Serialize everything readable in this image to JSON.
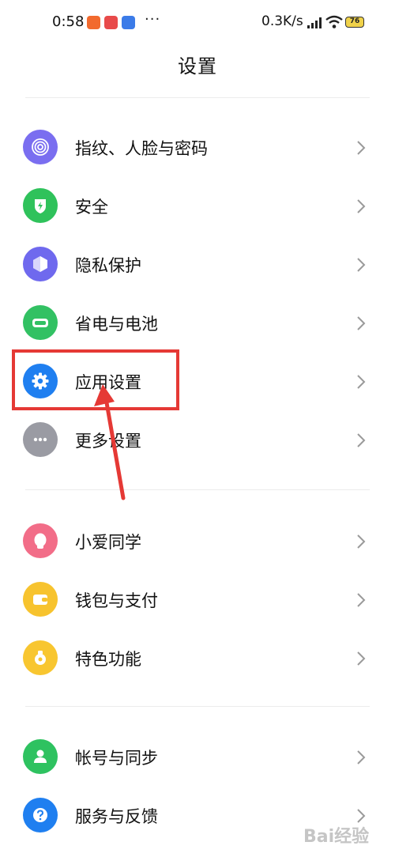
{
  "status_bar": {
    "time": "0:58",
    "dots": "···",
    "network_speed": "0.3K/s",
    "battery_level": "76",
    "colors": {
      "notif_1": "#f26a2e",
      "notif_2": "#e84a4a",
      "notif_3": "#3b7be8"
    }
  },
  "header": {
    "title": "设置"
  },
  "groups": [
    {
      "items": [
        {
          "label": "指纹、人脸与密码",
          "icon": "fingerprint-icon",
          "color": "#7a6ef0"
        },
        {
          "label": "安全",
          "icon": "shield-icon",
          "color": "#2fc25b"
        },
        {
          "label": "隐私保护",
          "icon": "privacy-icon",
          "color": "#6f69ee"
        },
        {
          "label": "省电与电池",
          "icon": "battery-icon",
          "color": "#32c163"
        },
        {
          "label": "应用设置",
          "icon": "gear-icon",
          "color": "#1f7ff0"
        },
        {
          "label": "更多设置",
          "icon": "more-icon",
          "color": "#9a9ba3"
        }
      ]
    },
    {
      "items": [
        {
          "label": "小爱同学",
          "icon": "assistant-icon",
          "color": "#f26d88"
        },
        {
          "label": "钱包与支付",
          "icon": "wallet-icon",
          "color": "#f7c32e"
        },
        {
          "label": "特色功能",
          "icon": "feature-icon",
          "color": "#f8c630"
        }
      ]
    },
    {
      "items": [
        {
          "label": "帐号与同步",
          "icon": "account-icon",
          "color": "#2ec260"
        },
        {
          "label": "服务与反馈",
          "icon": "help-icon",
          "color": "#1f7ff0"
        }
      ]
    }
  ],
  "annotation": {
    "highlight_color": "#e53935"
  },
  "watermark": {
    "text": "Bai经验"
  }
}
